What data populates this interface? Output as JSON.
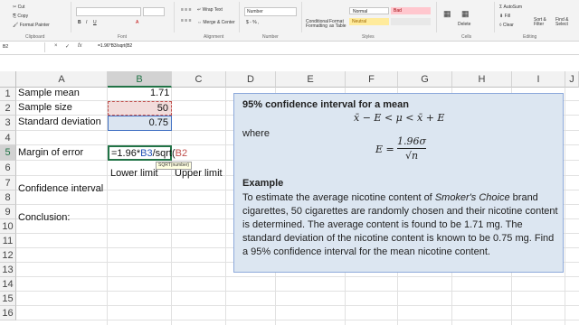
{
  "ribbon": {
    "clipboard": {
      "cut": "Cut",
      "copy": "Copy",
      "format_painter": "Format Painter",
      "group": "Clipboard"
    },
    "font_group": "Font",
    "alignment": {
      "wrap_text": "Wrap Text",
      "merge_center": "Merge & Center",
      "group": "Alignment"
    },
    "number": {
      "format": "Number",
      "group": "Number"
    },
    "styles": {
      "conditional_formatting": "Conditional Formatting",
      "format_as_table": "Format as Table",
      "normal": "Normal",
      "bad": "Bad",
      "neutral": "Neutral",
      "group": "Styles"
    },
    "cells": {
      "delete": "Delete",
      "group": "Cells"
    },
    "editing": {
      "autosum": "AutoSum",
      "fill": "Fill",
      "clear": "Clear",
      "sort_filter": "Sort & Filter",
      "find_select": "Find & Select",
      "group": "Editing"
    }
  },
  "formula_bar": {
    "name_box": "B2",
    "cancel": "×",
    "enter": "✓",
    "fx": "fx",
    "formula": "=1.96*B3/sqrt(B2"
  },
  "columns": [
    "A",
    "B",
    "C",
    "D",
    "E",
    "F",
    "G",
    "H",
    "I",
    "J"
  ],
  "rows": [
    "1",
    "2",
    "3",
    "4",
    "5",
    "6",
    "7",
    "8",
    "9",
    "10",
    "11",
    "12",
    "13",
    "14",
    "15",
    "16"
  ],
  "cells": {
    "A1": "Sample mean",
    "B1": "1.71",
    "A2": "Sample size",
    "B2": "50",
    "A3": "Standard deviation",
    "B3": "0.75",
    "A5": "Margin of error",
    "B6": "Lower limit",
    "C6": "Upper limit",
    "A7": "Confidence interval",
    "A9": "Conclusion:"
  },
  "editing_cell": {
    "prefix": "=1.96*",
    "ref1": "B3",
    "mid": "/sqrt(",
    "ref2": "B2",
    "tooltip": "SQRT(number)"
  },
  "textbox": {
    "title": "95% confidence interval for a mean",
    "interval_formula": "x̄ − E < μ < x̄ + E",
    "where": "where",
    "e_label": "E =",
    "e_numerator": "1.96σ",
    "e_denominator": "√n",
    "example_heading": "Example",
    "para_1": "To estimate the average nicotine content of ",
    "brand": "Smoker's Choice",
    "para_2": " brand cigarettes, 50 cigarettes are randomly chosen and their nicotine content is determined. The average content is found to be 1.71 mg. The standard deviation of the nicotine content is known to be 0.75 mg. Find a 95% confidence interval for the mean nicotine content."
  },
  "colors": {
    "accent": "#217346",
    "textbox_fill": "#dce6f1",
    "ref_blue": "#1f4fb5",
    "ref_red": "#c0504d"
  }
}
